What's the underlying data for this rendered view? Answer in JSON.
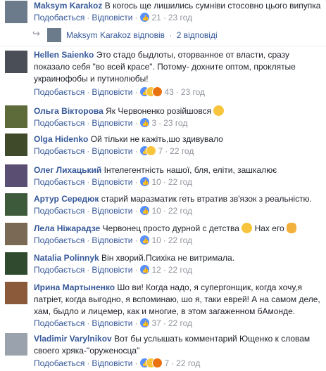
{
  "labels": {
    "like": "Подобається",
    "reply": "Відповісти",
    "dot": "·"
  },
  "comments": [
    {
      "author": "Maksym Karakoz",
      "text": "В когось ще лишились сумніви стосовно цього випупка",
      "reactions": [
        "like"
      ],
      "count": "21",
      "time": "23 год"
    },
    {
      "author": "Hellen Saienko",
      "text": "Это стадо быдлоты, оторванное от власти, сразу показало себя \"во всей красе\". Потому- дохните оптом, проклятые украинофобы и путинолюбы!",
      "reactions": [
        "like",
        "haha",
        "angry"
      ],
      "count": "43",
      "time": "23 год"
    },
    {
      "author": "Ольга Вікторова",
      "text": "Як Червоненко розійшовся",
      "reactions": [
        "like"
      ],
      "count": "3",
      "time": "23 год"
    },
    {
      "author": "Olga Hidenko",
      "text": "Ой тільки не кажіть,шо здивувало",
      "reactions": [
        "like",
        "haha"
      ],
      "count": "7",
      "time": "22 год"
    },
    {
      "author": "Олег Лихацький",
      "text": "Інтелегентність нашої, бля, еліти, зашкалює",
      "reactions": [
        "like"
      ],
      "count": "10",
      "time": "22 год"
    },
    {
      "author": "Артур Середюк",
      "text": "старий маразматик геть втратив зв'язок з реальністю.",
      "reactions": [
        "like"
      ],
      "count": "10",
      "time": "22 год"
    },
    {
      "author": "Лела Ніжарадзе",
      "text": "Червонец просто дурной с детства",
      "text2": "Нах его",
      "reactions": [
        "like"
      ],
      "count": "10",
      "time": "22 год"
    },
    {
      "author": "Natalia Polinnyk",
      "text": "Він хворий.Психіка не витримала.",
      "reactions": [
        "like"
      ],
      "count": "12",
      "time": "22 год"
    },
    {
      "author": "Ирина Мартыненко",
      "text": "Шо ви! Когда надо, я супергонщик, когда хочу,я патріет, когда выгодно, я вспоминаю, шо я, таки еврей! А на самом деле, хам, быдло и лицемер, как и многие, в этом загаженном бАмонде.",
      "reactions": [
        "like"
      ],
      "count": "37",
      "time": "22 год"
    },
    {
      "author": "Vladimir Varylnikov",
      "text": "Вот бы услышать комментарий Ющенко к словам своего хряка-\"оруженосца\"",
      "reactions": [
        "like",
        "haha",
        "angry"
      ],
      "count": "7",
      "time": "22 год"
    }
  ],
  "reply_thread": {
    "author": "Maksym Karakoz",
    "action": "відповів",
    "count_label": "2 відповіді"
  }
}
